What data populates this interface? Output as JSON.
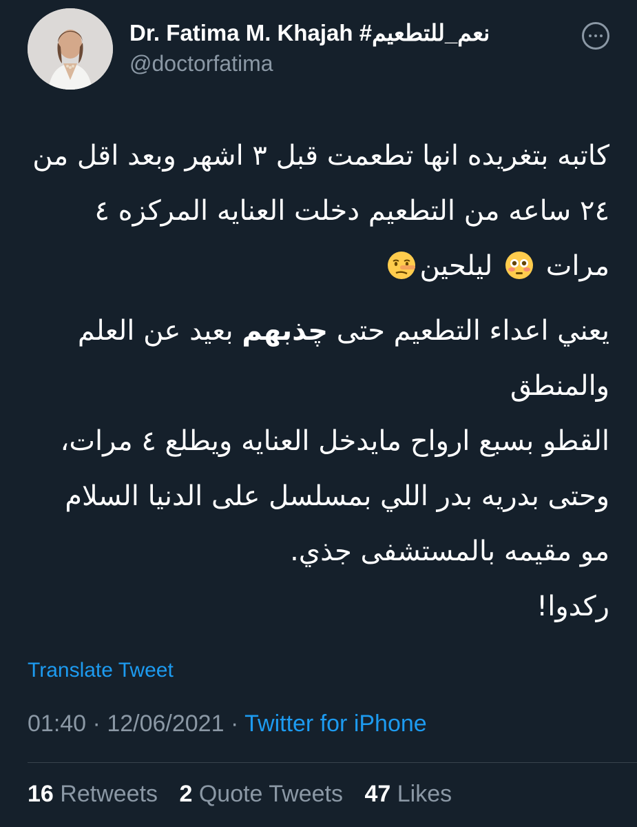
{
  "author": {
    "display_name": "Dr. Fatima M. Khajah #نعم_للتطعيم",
    "handle": "@doctorfatima"
  },
  "tweet": {
    "paragraph1": {
      "line1": "كاتبه بتغريده انها تطعمت قبل ٣ اشهر وبعد",
      "line2": "اقل من ٢٤ ساعه من التطعيم دخلت العنايه",
      "line3_text": "المركزه ٤ مرات",
      "line3_after_emoji1": "ليلحين",
      "emoji1": "flushed-face",
      "emoji2": "lying-face"
    },
    "paragraph2": {
      "before_bold": "يعني اعداء التطعيم حتى",
      "bold_word": "چذبهم",
      "after_bold": "بعيد عن العلم والمنطق",
      "line3": "القطو بسبع ارواح مايدخل العنايه ويطلع ٤ مرات، وحتى بدريه بدر اللي بمسلسل على الدنيا السلام مو مقيمه بالمستشفى جذي.",
      "line4": "ركدوا!"
    }
  },
  "translate_label": "Translate Tweet",
  "meta": {
    "time": "01:40",
    "separator": "·",
    "date": "12/06/2021",
    "source": "Twitter for iPhone"
  },
  "stats": {
    "retweets_count": "16",
    "retweets_label": "Retweets",
    "quotes_count": "2",
    "quotes_label": "Quote Tweets",
    "likes_count": "47",
    "likes_label": "Likes"
  },
  "colors": {
    "background": "#15202b",
    "text": "#ffffff",
    "secondary": "#8b98a5",
    "accent": "#1d9bf0",
    "divider": "#38444d"
  }
}
